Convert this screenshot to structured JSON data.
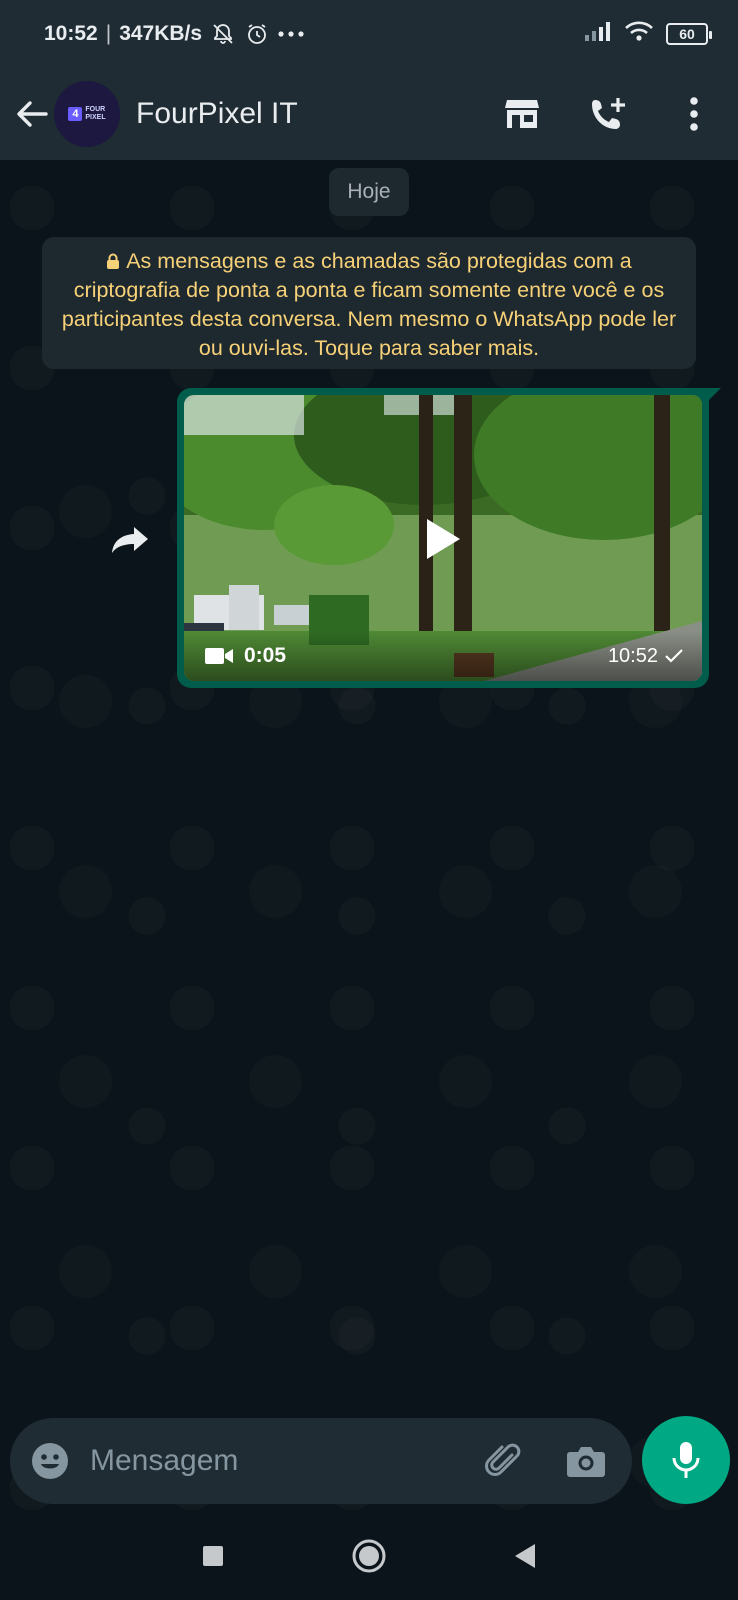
{
  "status_bar": {
    "time": "10:52",
    "separator": "|",
    "net_speed": "347KB/s",
    "battery": "60",
    "icons": [
      "mute-notifications-icon",
      "alarm-icon",
      "more-dots-icon",
      "signal-icon",
      "wifi-icon",
      "battery-icon"
    ]
  },
  "header": {
    "contact_name": "FourPixel IT",
    "avatar_logo_number": "4",
    "avatar_logo_text_line1": "FOUR",
    "avatar_logo_text_line2": "PIXEL",
    "icons": [
      "back-arrow-icon",
      "store-icon",
      "add-call-icon",
      "more-vert-icon"
    ]
  },
  "chat": {
    "date_chip": "Hoje",
    "encryption_notice": "As mensagens e as chamadas são protegidas com a criptografia de ponta a ponta e ficam somente entre você e os participantes desta conversa. Nem mesmo o WhatsApp pode ler ou ouvi-las. Toque para saber mais.",
    "message": {
      "type": "video",
      "duration": "0:05",
      "time": "10:52",
      "status": "sent"
    }
  },
  "composer": {
    "placeholder": "Mensagem",
    "value": ""
  },
  "colors": {
    "header_bg": "#1f2c34",
    "chat_bg": "#0b141a",
    "outgoing_bubble": "#005c4b",
    "accent": "#00a884",
    "notice_text": "#f7d177"
  }
}
